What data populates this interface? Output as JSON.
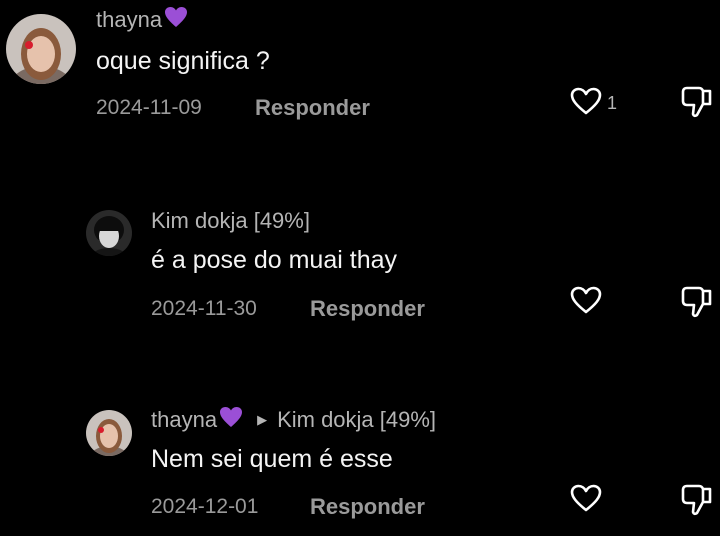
{
  "comments": [
    {
      "username": "thayna",
      "text": "oque significa ?",
      "date": "2024-11-09",
      "reply_label": "Responder",
      "likes": "1"
    },
    {
      "username": "Kim dokja [49%]",
      "text": "é a pose do muai thay",
      "date": "2024-11-30",
      "reply_label": "Responder"
    },
    {
      "username": "thayna",
      "reply_to": "Kim dokja [49%]",
      "text": "Nem sei quem é esse",
      "date": "2024-12-01",
      "reply_label": "Responder"
    }
  ],
  "colors": {
    "background": "#000000",
    "username": "#b5b5b5",
    "text": "#f4f4f4",
    "meta": "#9a9a9a",
    "purple_heart": "#9b4fd6"
  }
}
